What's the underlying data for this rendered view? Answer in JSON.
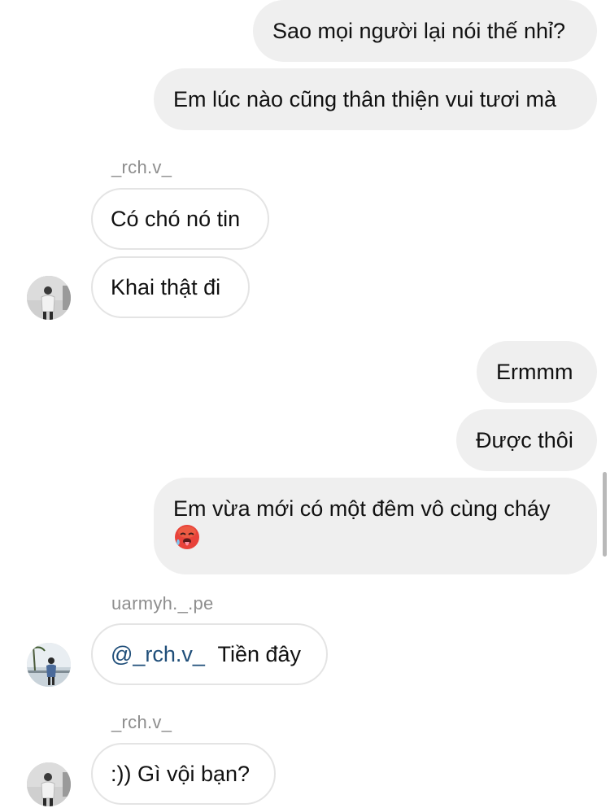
{
  "messages": [
    {
      "id": "m1",
      "direction": "outgoing",
      "text": "Sao mọi người lại nói thế nhỉ?"
    },
    {
      "id": "m2",
      "direction": "outgoing",
      "text": "Em lúc nào cũng thân thiện vui tươi mà"
    },
    {
      "id": "m3",
      "direction": "incoming",
      "sender": "_rch.v_",
      "text": "Có chó nó tin"
    },
    {
      "id": "m4",
      "direction": "incoming",
      "text": "Khai thật đi"
    },
    {
      "id": "m5",
      "direction": "outgoing",
      "text": "Ermmm"
    },
    {
      "id": "m6",
      "direction": "outgoing",
      "text": "Được thôi"
    },
    {
      "id": "m7",
      "direction": "outgoing",
      "text": "Em vừa mới có một đêm vô cùng cháy",
      "emoji": "hot-face-emoji"
    },
    {
      "id": "m8",
      "direction": "incoming",
      "sender": "uarmyh._.pe",
      "mention": "@_rch.v_",
      "text": "Tiền đây"
    },
    {
      "id": "m9",
      "direction": "incoming",
      "sender": "_rch.v_",
      "text": ":)) Gì vội bạn?"
    }
  ],
  "senders": {
    "rch": "_rch.v_",
    "uarmyh": "uarmyh._.pe"
  },
  "colors": {
    "outgoing_bubble": "#efefef",
    "incoming_border": "#e4e4e4",
    "sender_label": "#8e8e8e",
    "mention": "#1f4e79"
  }
}
